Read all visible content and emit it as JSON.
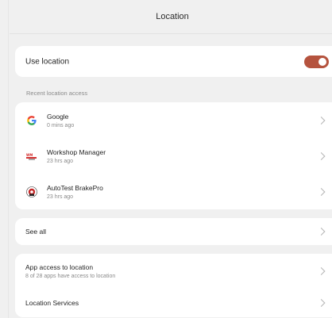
{
  "header": {
    "title": "Location"
  },
  "use_location": {
    "label": "Use location",
    "enabled": true,
    "toggle_color": "#b5533e"
  },
  "recent": {
    "header": "Recent location access",
    "items": [
      {
        "name": "Google",
        "time": "0 mins ago",
        "icon": "google-icon"
      },
      {
        "name": "Workshop Manager",
        "time": "23 hrs ago",
        "icon": "workshop-manager-icon"
      },
      {
        "name": "AutoTest BrakePro",
        "time": "23 hrs ago",
        "icon": "autotest-brakepro-icon"
      }
    ]
  },
  "see_all": {
    "label": "See all"
  },
  "app_access": {
    "label": "App access to location",
    "subtitle": "8 of 28 apps have access to location"
  },
  "location_services": {
    "label": "Location Services"
  }
}
